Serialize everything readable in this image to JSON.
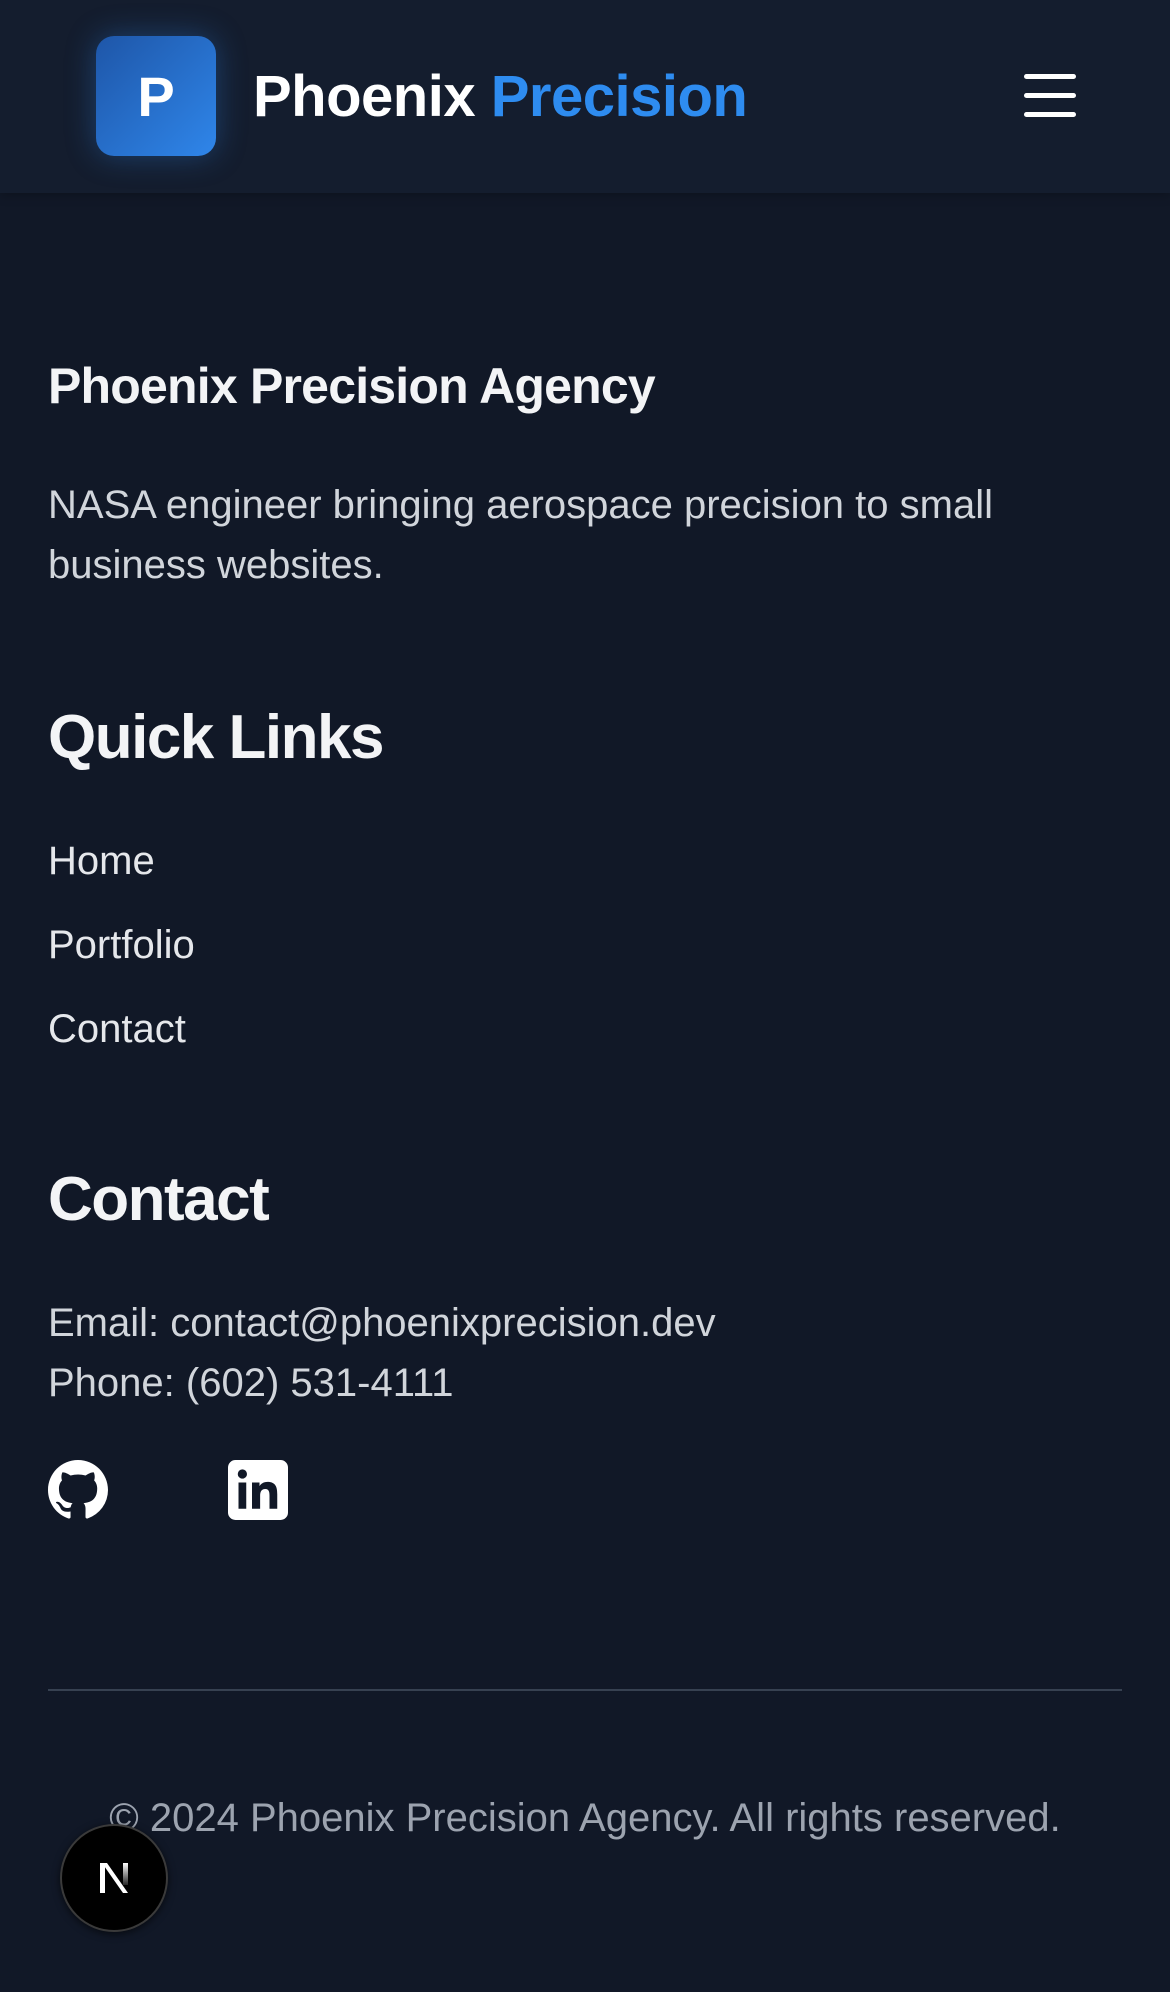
{
  "header": {
    "logo_letter": "P",
    "brand_part1": "Phoenix",
    "brand_part2": "Precision",
    "menu_icon": "hamburger-menu-icon"
  },
  "footer": {
    "agency_title": "Phoenix Precision Agency",
    "agency_description": "NASA engineer bringing aerospace precision to small business websites.",
    "quick_links": {
      "title": "Quick Links",
      "links": [
        "Home",
        "Portfolio",
        "Contact"
      ]
    },
    "contact": {
      "title": "Contact",
      "email_line": "Email: contact@phoenixprecision.dev",
      "phone_line": "Phone: (602) 531-4111"
    },
    "social_icons": [
      "github-icon",
      "linkedin-icon"
    ],
    "copyright": "© 2024 Phoenix Precision Agency. All rights reserved."
  },
  "dev_badge": {
    "letter": "N",
    "icon": "nextjs-icon"
  },
  "colors": {
    "background": "#111827",
    "header_background": "#141d2e",
    "accent": "#2e8cf0",
    "logo_gradient_start": "#1e56a8",
    "logo_gradient_end": "#2f86ea"
  }
}
